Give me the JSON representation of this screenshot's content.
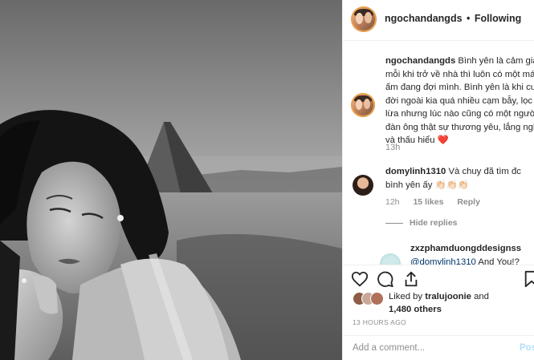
{
  "header": {
    "username": "ngochandangds",
    "separator": "•",
    "follow_status": "Following"
  },
  "caption": {
    "username": "ngochandangds",
    "lines": [
      "Bình yên là cảm giác",
      "mỗi khi trở về nhà thì luôn có một mái",
      "ấm đang đợi mình. Bình yên là khi cuộc",
      "đời ngoài kia quá nhiều cạm bẫy, lọc",
      "lừa nhưng lúc nào cũng có một người",
      "đàn ông thật sự thương yêu, lắng nghe",
      "và thấu hiểu ❤️"
    ],
    "time": "13h"
  },
  "comments": [
    {
      "username": "domylinh1310",
      "text_line1": "Và chuy đã tìm đc",
      "text_line2": "bình yên ấy 👏🏻👏🏻👏🏻",
      "time": "12h",
      "likes": "15 likes",
      "reply": "Reply",
      "hide_replies": "Hide replies"
    }
  ],
  "replies": [
    {
      "username": "zxzphamduongddesignss",
      "mention": "@domylinh1310",
      "text": "And You!?"
    }
  ],
  "actions": {
    "like_icon": "heart-icon",
    "comment_icon": "comment-icon",
    "share_icon": "share-icon",
    "save_icon": "bookmark-icon"
  },
  "likes": {
    "prefix": "Liked by",
    "user": "tralujoonie",
    "and": "and",
    "count": "1,480 others"
  },
  "post_time": "13 HOURS AGO",
  "add_comment": {
    "placeholder": "Add a comment...",
    "post_label": "Post"
  },
  "colors": {
    "text": "#262626",
    "secondary": "#8e8e8e",
    "post_disabled": "#b2dffc",
    "mention": "#003569",
    "heart": "#ed4956"
  }
}
